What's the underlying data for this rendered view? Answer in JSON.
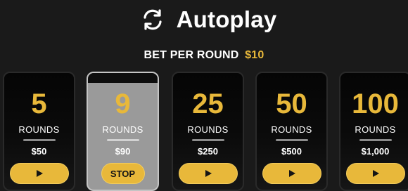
{
  "header": {
    "title": "Autoplay",
    "icon": "autoplay-cycle-icon"
  },
  "bet": {
    "label": "BET PER ROUND",
    "value": "$10"
  },
  "colors": {
    "accent": "#e8b83a",
    "background": "#1a1a1a",
    "active_card": "#9a9a9a"
  },
  "cards": [
    {
      "rounds": "5",
      "rounds_label": "ROUNDS",
      "amount": "$50",
      "button": "play-icon",
      "active": false
    },
    {
      "rounds": "9",
      "rounds_label": "ROUNDS",
      "amount": "$90",
      "button": "STOP",
      "active": true
    },
    {
      "rounds": "25",
      "rounds_label": "ROUNDS",
      "amount": "$250",
      "button": "play-icon",
      "active": false
    },
    {
      "rounds": "50",
      "rounds_label": "ROUNDS",
      "amount": "$500",
      "button": "play-icon",
      "active": false
    },
    {
      "rounds": "100",
      "rounds_label": "ROUNDS",
      "amount": "$1,000",
      "button": "play-icon",
      "active": false
    }
  ]
}
